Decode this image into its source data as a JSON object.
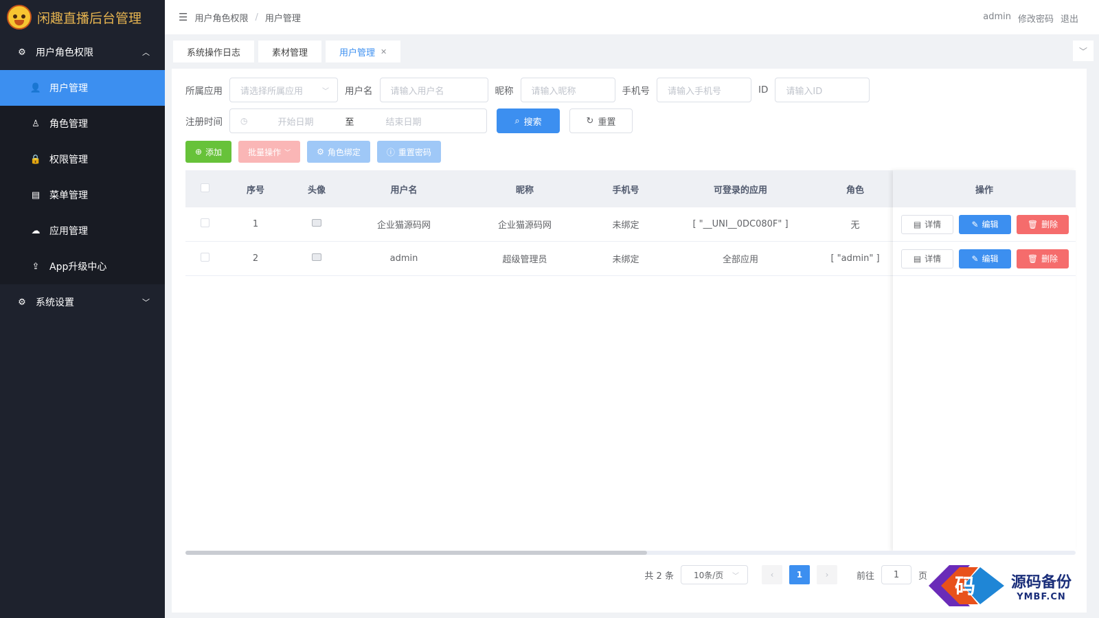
{
  "app": {
    "title": "闲趣直播后台管理"
  },
  "sidebar": {
    "groups": [
      {
        "label": "用户角色权限",
        "icon": "gear-icon",
        "expanded": true,
        "items": [
          {
            "label": "用户管理",
            "icon": "user-icon",
            "active": true
          },
          {
            "label": "角色管理",
            "icon": "user-outline-icon"
          },
          {
            "label": "权限管理",
            "icon": "lock-icon"
          },
          {
            "label": "菜单管理",
            "icon": "document-icon"
          },
          {
            "label": "应用管理",
            "icon": "cloud-icon"
          },
          {
            "label": "App升级中心",
            "icon": "cloud-upload-icon"
          }
        ]
      },
      {
        "label": "系统设置",
        "icon": "gear-icon",
        "expanded": false
      }
    ]
  },
  "breadcrumb": [
    "用户角色权限",
    "用户管理"
  ],
  "top_links": [
    "admin",
    "修改密码",
    "退出"
  ],
  "tabs": [
    {
      "label": "系统操作日志"
    },
    {
      "label": "素材管理"
    },
    {
      "label": "用户管理",
      "active": true
    }
  ],
  "filters": {
    "app_label": "所属应用",
    "app_placeholder": "请选择所属应用",
    "username_label": "用户名",
    "username_placeholder": "请输入用户名",
    "nickname_label": "昵称",
    "nickname_placeholder": "请输入昵称",
    "phone_label": "手机号",
    "phone_placeholder": "请输入手机号",
    "id_label": "ID",
    "id_placeholder": "请输入ID",
    "date_label": "注册时间",
    "start_placeholder": "开始日期",
    "range_sep": "至",
    "end_placeholder": "结束日期",
    "search_label": "搜索",
    "reset_label": "重置"
  },
  "toolbar": {
    "add": "添加",
    "batch": "批量操作",
    "bind_role": "角色绑定",
    "reset_pwd": "重置密码"
  },
  "table": {
    "headers": [
      "序号",
      "头像",
      "用户名",
      "昵称",
      "手机号",
      "可登录的应用",
      "角色",
      "操作"
    ],
    "rows": [
      {
        "index": "1",
        "username": "企业猫源码网",
        "nickname": "企业猫源码网",
        "phone": "未绑定",
        "apps": "[ \"__UNI__0DC080F\" ]",
        "role": "无"
      },
      {
        "index": "2",
        "username": "admin",
        "nickname": "超级管理员",
        "phone": "未绑定",
        "apps": "全部应用",
        "role": "[ \"admin\" ]"
      }
    ],
    "actions": {
      "detail": "详情",
      "edit": "编辑",
      "delete": "删除"
    }
  },
  "pagination": {
    "total": "共 2 条",
    "page_size": "10条/页",
    "current": "1",
    "goto_label": "前往",
    "goto_value": "1",
    "page_unit": "页"
  },
  "watermark": {
    "glyph": "码",
    "title": "源码备份",
    "subtitle": "YMBF.CN"
  },
  "colors": {
    "primary": "#3c8ff0",
    "success": "#67c23a",
    "danger": "#f56c6c",
    "sidebar": "#1e222d"
  }
}
